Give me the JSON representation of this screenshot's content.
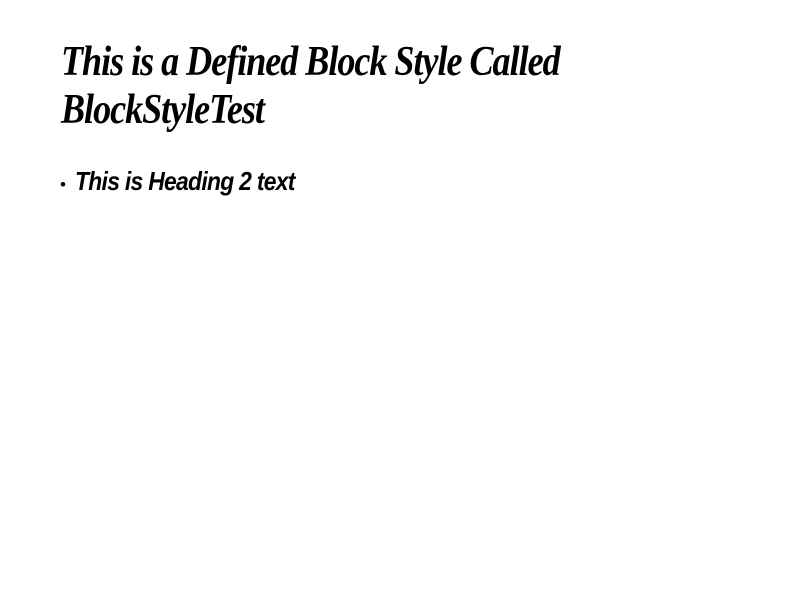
{
  "document": {
    "block_style_heading": "This is a Defined Block Style Called BlockStyleTest",
    "bullet_symbol": "•",
    "heading2_text": "This is Heading 2 text",
    "text_color": "#000000",
    "background_color": "#ffffff"
  }
}
